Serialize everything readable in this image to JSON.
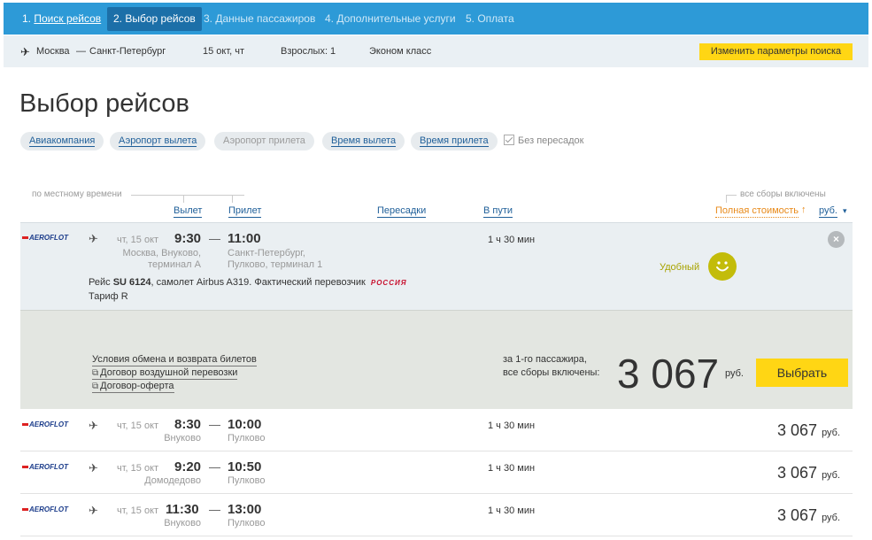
{
  "steps": [
    {
      "num": "1.",
      "label": "Поиск рейсов"
    },
    {
      "num": "",
      "label": "2. Выбор рейсов"
    },
    {
      "num": "",
      "label": "3. Данные пассажиров"
    },
    {
      "num": "",
      "label": "4. Дополнительные услуги"
    },
    {
      "num": "",
      "label": "5. Оплата"
    }
  ],
  "summary": {
    "from": "Москва",
    "dash": "—",
    "to": "Санкт-Петербург",
    "date": "15 окт, чт",
    "adults": "Взрослых: 1",
    "class": "Эконом класс",
    "change_label": "Изменить параметры поиска"
  },
  "page_title": "Выбор рейсов",
  "filters": {
    "airline": "Авиакомпания",
    "dep_airport": "Аэропорт вылета",
    "arr_airport": "Аэропорт прилета",
    "dep_time": "Время вылета",
    "arr_time": "Время прилета",
    "nonstop": "Без пересадок"
  },
  "headings": {
    "local_time": "по местному времени",
    "departure": "Вылет",
    "arrival": "Прилет",
    "stops": "Пересадки",
    "duration": "В пути",
    "fees_included": "все сборы включены",
    "full_price": "Полная стоимость",
    "sort_arrow": "↑",
    "currency": "руб.",
    "currency_arrow": "▾"
  },
  "selected": {
    "airline": "AEROFLOT",
    "date": "чт, 15 окт",
    "dep_time": "9:30",
    "arr_time": "11:00",
    "dep_airport_1": "Москва, Внуково,",
    "dep_airport_2": "терминал А",
    "arr_airport_1": "Санкт-Петербург,",
    "arr_airport_2": "Пулково, терминал 1",
    "duration": "1 ч 30 мин",
    "convenient": "Удобный",
    "flight_prefix": "Рейс",
    "flight_no": "SU 6124",
    "flight_suffix": ", самолет Airbus A319. Фактический перевозчик",
    "carrier": "РОССИЯ",
    "tariff": "Тариф R",
    "close": "×",
    "links": [
      "Условия обмена и возврата билетов",
      "Договор воздушной перевозки",
      "Договор-оферта"
    ],
    "per_pax_1": "за 1-го пассажира,",
    "per_pax_2": "все сборы включены:",
    "price": "3 067",
    "rub": "руб.",
    "choose": "Выбрать"
  },
  "flights": [
    {
      "airline": "AEROFLOT",
      "date": "чт, 15 окт",
      "dep_time": "8:30",
      "arr_time": "10:00",
      "dep_airport": "Внуково",
      "arr_airport": "Пулково",
      "duration": "1 ч 30 мин",
      "price": "3 067",
      "rub": "руб."
    },
    {
      "airline": "AEROFLOT",
      "date": "чт, 15 окт",
      "dep_time": "9:20",
      "arr_time": "10:50",
      "dep_airport": "Домодедово",
      "arr_airport": "Пулково",
      "duration": "1 ч 30 мин",
      "price": "3 067",
      "rub": "руб."
    },
    {
      "airline": "AEROFLOT",
      "date": "чт, 15 окт",
      "dep_time": "11:30",
      "arr_time": "13:00",
      "dep_airport": "Внуково",
      "arr_airport": "Пулково",
      "duration": "1 ч 30 мин",
      "price": "3 067",
      "rub": "руб."
    }
  ],
  "colors": {
    "header": "#2d9ad7",
    "active_step": "#1c6fa8",
    "accent_yellow": "#ffd614",
    "link": "#1f5f99",
    "sort_orange": "#e88a1a"
  }
}
